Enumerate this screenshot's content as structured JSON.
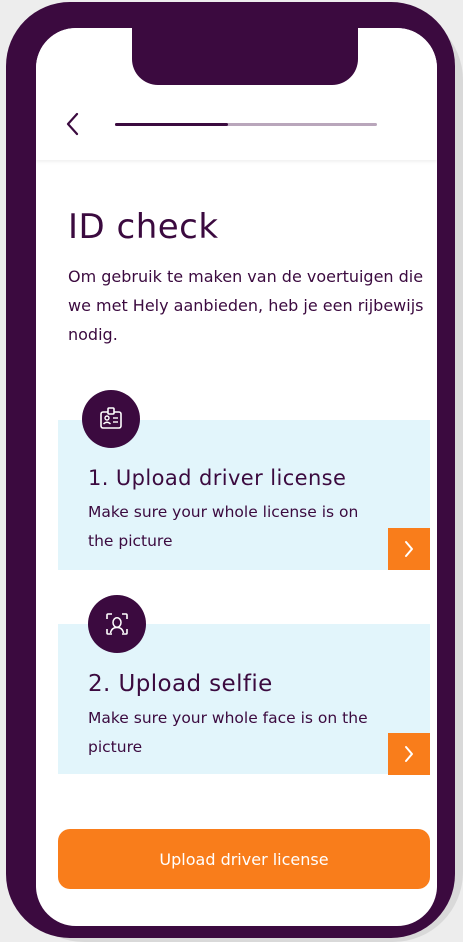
{
  "header": {
    "back_icon": "chevron-left-icon",
    "progress_fraction": 0.43
  },
  "main": {
    "title": "ID check",
    "intro": "Om gebruik te maken van de voertuigen die we met Hely aanbieden, heb je een rijbewijs nodig.",
    "steps": [
      {
        "icon": "id-card-icon",
        "title": "1. Upload driver license",
        "description": "Make sure your whole license is on the picture",
        "action_icon": "chevron-right-icon"
      },
      {
        "icon": "face-scan-icon",
        "title": "2. Upload selfie",
        "description": "Make sure your whole face is on the picture",
        "action_icon": "chevron-right-icon"
      }
    ],
    "cta_label": "Upload driver license"
  },
  "colors": {
    "primary": "#3b0a3f",
    "accent": "#f97d1b",
    "card_background": "#e2f5fb"
  }
}
